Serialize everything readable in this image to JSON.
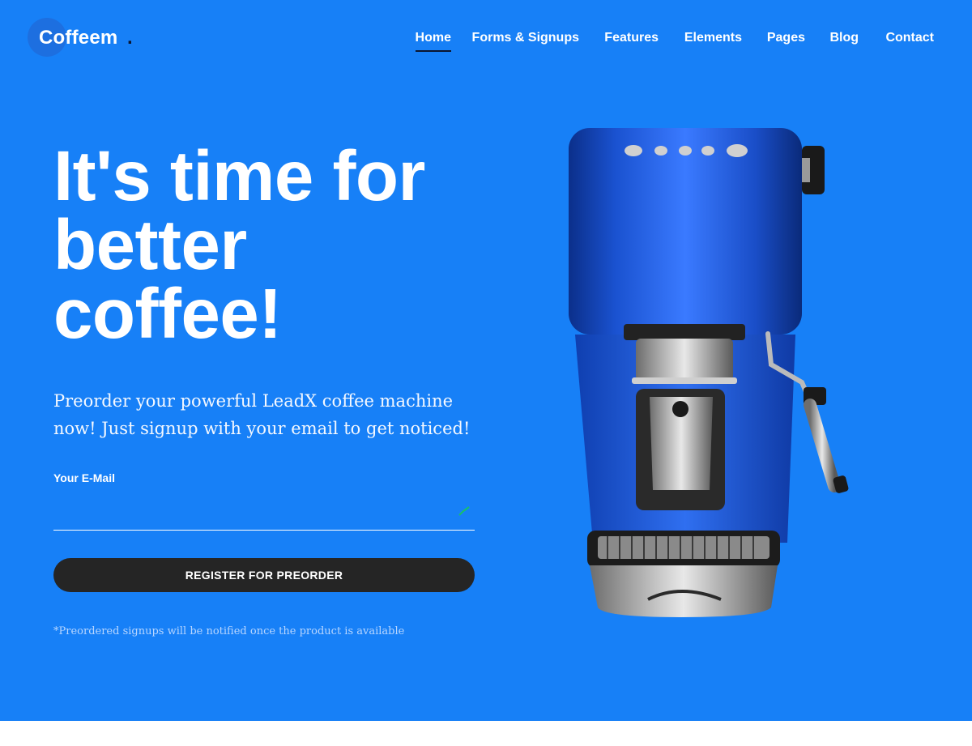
{
  "brand": {
    "name": "Coffeem",
    "dot": "."
  },
  "nav": {
    "items": [
      "Home",
      "Forms & Signups",
      "Features",
      "Elements",
      "Pages",
      "Blog",
      "Contact"
    ],
    "active": "Home"
  },
  "hero": {
    "headline": "It's time for better coffee!",
    "subtitle": "Preorder your powerful LeadX coffee machine now! Just signup with your email to get noticed!",
    "email_label": "Your E-Mail",
    "email_value": "",
    "email_placeholder": "",
    "button_label": "REGISTER FOR PREORDER",
    "note": "*Preordered signups will be notified once the product is available"
  },
  "colors": {
    "hero_bg": "#1780f7",
    "button_bg": "#252525",
    "text": "#ffffff"
  },
  "icons": {
    "email_valid": "checkmark-icon",
    "product": "coffee-machine-image"
  }
}
